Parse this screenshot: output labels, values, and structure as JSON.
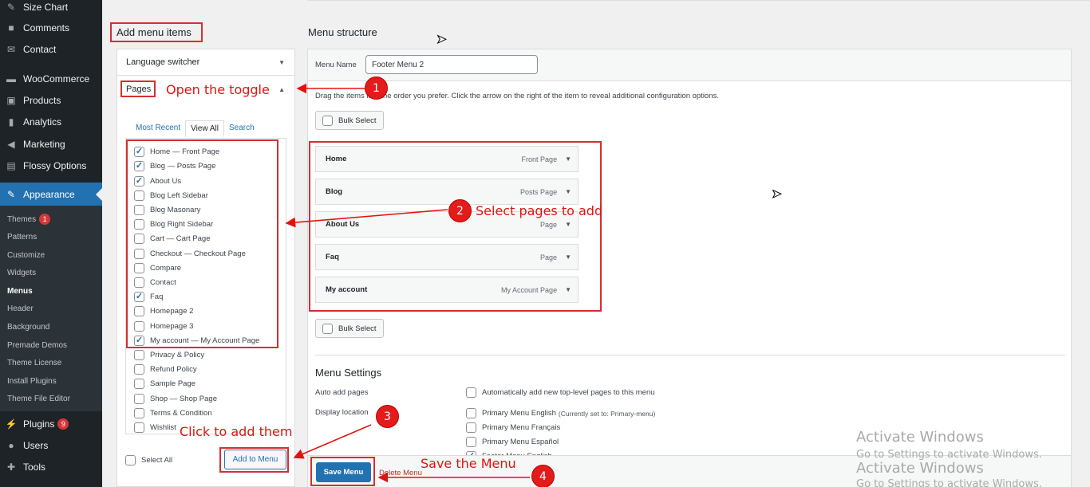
{
  "sidebar": {
    "items": [
      {
        "label": "Size Chart",
        "icon": "ruler-icon"
      },
      {
        "label": "Comments",
        "icon": "comment-icon"
      },
      {
        "label": "Contact",
        "icon": "mail-icon"
      },
      {
        "label": "WooCommerce",
        "icon": "woo-icon"
      },
      {
        "label": "Products",
        "icon": "box-icon"
      },
      {
        "label": "Analytics",
        "icon": "chart-icon"
      },
      {
        "label": "Marketing",
        "icon": "megaphone-icon"
      },
      {
        "label": "Flossy Options",
        "icon": "options-icon"
      },
      {
        "label": "Appearance",
        "icon": "brush-icon"
      }
    ],
    "submenu": [
      {
        "label": "Themes",
        "badge": "1"
      },
      {
        "label": "Patterns"
      },
      {
        "label": "Customize"
      },
      {
        "label": "Widgets"
      },
      {
        "label": "Menus"
      },
      {
        "label": "Header"
      },
      {
        "label": "Background"
      },
      {
        "label": "Premade Demos"
      },
      {
        "label": "Theme License"
      },
      {
        "label": "Install Plugins"
      },
      {
        "label": "Theme File Editor"
      }
    ],
    "lower": [
      {
        "label": "Plugins",
        "badge": "9",
        "icon": "plug-icon"
      },
      {
        "label": "Users",
        "icon": "user-icon"
      },
      {
        "label": "Tools",
        "icon": "wrench-icon"
      }
    ]
  },
  "left": {
    "heading": "Add menu items",
    "language_switcher": "Language switcher",
    "pages_label": "Pages",
    "tabs": [
      "Most Recent",
      "View All",
      "Search"
    ],
    "pages": [
      {
        "label": "Home — Front Page",
        "checked": true
      },
      {
        "label": "Blog — Posts Page",
        "checked": true
      },
      {
        "label": "About Us",
        "checked": true
      },
      {
        "label": "Blog Left Sidebar",
        "checked": false
      },
      {
        "label": "Blog Masonary",
        "checked": false
      },
      {
        "label": "Blog Right Sidebar",
        "checked": false
      },
      {
        "label": "Cart — Cart Page",
        "checked": false
      },
      {
        "label": "Checkout — Checkout Page",
        "checked": false
      },
      {
        "label": "Compare",
        "checked": false
      },
      {
        "label": "Contact",
        "checked": false
      },
      {
        "label": "Faq",
        "checked": true
      },
      {
        "label": "Homepage 2",
        "checked": false
      },
      {
        "label": "Homepage 3",
        "checked": false
      },
      {
        "label": "My account — My Account Page",
        "checked": true
      },
      {
        "label": "Privacy & Policy",
        "checked": false
      },
      {
        "label": "Refund Policy",
        "checked": false
      },
      {
        "label": "Sample Page",
        "checked": false
      },
      {
        "label": "Shop — Shop Page",
        "checked": false
      },
      {
        "label": "Terms & Condition",
        "checked": false
      },
      {
        "label": "Wishlist",
        "checked": false
      }
    ],
    "select_all": "Select All",
    "add_to_menu": "Add to Menu"
  },
  "right": {
    "heading": "Menu structure",
    "menu_name_label": "Menu Name",
    "menu_name_value": "Footer Menu 2",
    "instructions": "Drag the items into the order you prefer. Click the arrow on the right of the item to reveal additional configuration options.",
    "bulk_select": "Bulk Select",
    "menu_items": [
      {
        "title": "Home",
        "type": "Front Page"
      },
      {
        "title": "Blog",
        "type": "Posts Page"
      },
      {
        "title": "About Us",
        "type": "Page"
      },
      {
        "title": "Faq",
        "type": "Page"
      },
      {
        "title": "My account",
        "type": "My Account Page"
      }
    ],
    "settings_heading": "Menu Settings",
    "auto_add_label": "Auto add pages",
    "auto_add_option": "Automatically add new top-level pages to this menu",
    "display_location_label": "Display location",
    "locations": [
      {
        "label": "Primary Menu English",
        "note": "(Currently set to: Primary-menu)"
      },
      {
        "label": "Primary Menu Français",
        "note": ""
      },
      {
        "label": "Primary Menu Español",
        "note": ""
      },
      {
        "label": "Footer Menu English",
        "note": ""
      }
    ],
    "save_menu": "Save Menu",
    "delete_menu": "Delete Menu"
  },
  "annotations": {
    "step1": {
      "num": "1",
      "text": "Open the toggle"
    },
    "step2": {
      "num": "2",
      "text": "Select pages to add"
    },
    "step3": {
      "num": "3",
      "text": "Click to add them"
    },
    "step4": {
      "num": "4",
      "text": "Save the Menu"
    },
    "color": "#e4120f"
  },
  "watermark": {
    "title": "Activate Windows",
    "subtitle": "Go to Settings to activate Windows."
  },
  "colors": {
    "sidebar_bg": "#1d2327",
    "accent": "#2271b1",
    "highlight": "#d32f2f"
  }
}
